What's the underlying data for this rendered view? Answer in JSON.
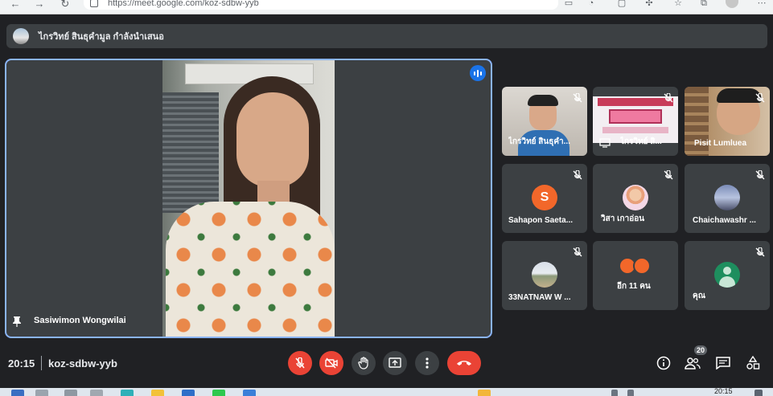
{
  "browser": {
    "url": "https://meet.google.com/koz-sdbw-yyb"
  },
  "banner": {
    "text": "ไกรวิทย์ สินธุคำมูล กำลังนำเสนอ"
  },
  "main_speaker": {
    "name": "Sasiwimon Wongwilai"
  },
  "participants": [
    {
      "name": "ไกรวิทย์ สินธุคำ..."
    },
    {
      "name": "ไกรวิทย์ สิ..."
    },
    {
      "name": "Pisit Lumluea"
    },
    {
      "name": "Sahapon Saeta...",
      "avatar_letter": "S"
    },
    {
      "name": "วิสา เกาอ่อน"
    },
    {
      "name": "Chaichawashr ..."
    },
    {
      "name": "33NATNAW W ..."
    },
    {
      "name": "อีก 11 คน"
    },
    {
      "name": "คุณ"
    }
  ],
  "bottom_bar": {
    "time": "20:15",
    "meeting_code": "koz-sdbw-yyb",
    "people_count": "20"
  },
  "taskbar": {
    "time": "20:15"
  },
  "colors": {
    "background": "#202124",
    "tile": "#3c4043",
    "active_border": "#8ab4f8",
    "danger": "#ea4335"
  }
}
